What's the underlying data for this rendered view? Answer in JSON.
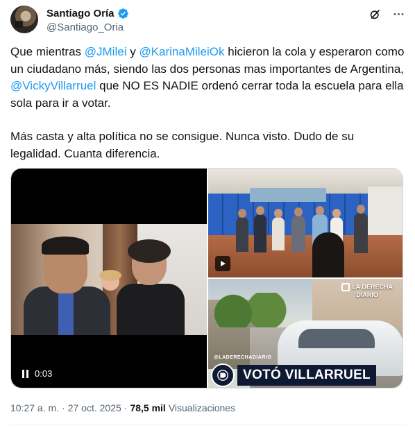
{
  "author": {
    "display_name": "Santiago Oría",
    "handle": "@Santiago_Oria",
    "verified": true
  },
  "header_icons": [
    "grok-icon",
    "more-icon"
  ],
  "tweet_text": {
    "p1_part1": "Que mientras ",
    "mention1": "@JMilei",
    "p1_part2": " y ",
    "mention2": "@KarinaMileiOk",
    "p1_part3": " hicieron la cola y esperaron como un ciudadano más, siendo las dos personas mas importantes de Argentina, ",
    "mention3": "@VickyVillarruel",
    "p1_part4": " que NO ES NADIE ordenó cerrar toda la escuela para ella sola para ir a votar.",
    "p2": "Más casta y alta política no se consigue. Nunca visto. Dudo de su legalidad. Cuanta diferencia."
  },
  "media": {
    "video_time": "0:03",
    "bottom_image": {
      "logo_line1": "LA DERECHA",
      "logo_line2": "DIARIO",
      "ticker": "@LADERECHADIARIO",
      "banner": "VOTÓ VILLARRUEL"
    }
  },
  "meta": {
    "time": "10:27 a. m.",
    "separator": "·",
    "date": "27 oct. 2025",
    "views_count": "78,5 mil",
    "views_label": "Visualizaciones"
  },
  "colors": {
    "link": "#1d9bf0",
    "text": "#0f1419",
    "secondary": "#536471",
    "verified": "#1d9bf0"
  }
}
